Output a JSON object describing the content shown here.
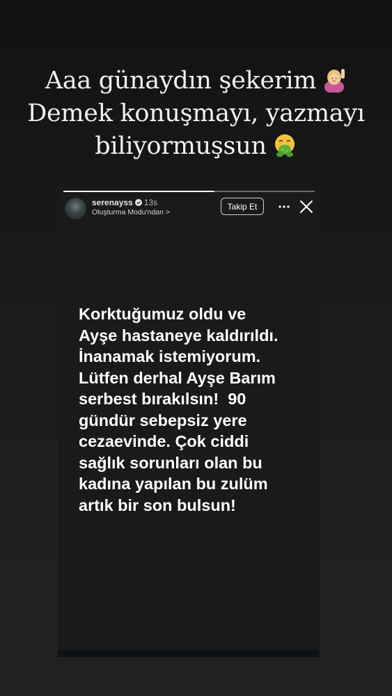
{
  "caption": {
    "lines": [
      "Aaa günaydın şekerim",
      "Demek konuşmayı, yazmayı",
      "biliyormuşsun"
    ],
    "emoji_1": "raising-hand-woman-emoji",
    "emoji_2": "nauseated-face-emoji"
  },
  "story": {
    "progress": 0.6,
    "username": "serenayss",
    "time": "13s",
    "mode_link": "Oluşturma Modu'ndan >",
    "follow_label": "Takip Et",
    "body_lines": [
      "Korktuğumuz oldu ve",
      "Ayşe hastaneye kaldırıldı.",
      "İnanamak istemiyorum.",
      "Lütfen derhal Ayşe Barım",
      "serbest bırakılsın!  90",
      "gündür sebepsiz yere",
      "cezaevinde. Çok ciddi",
      "sağlık sorunları olan bu",
      "kadına yapılan bu zulüm",
      "artık bir son bulsun!"
    ]
  },
  "colors": {
    "background": "#1b1b1b",
    "story_background": "#1a1a1a",
    "text": "#ffffff"
  }
}
